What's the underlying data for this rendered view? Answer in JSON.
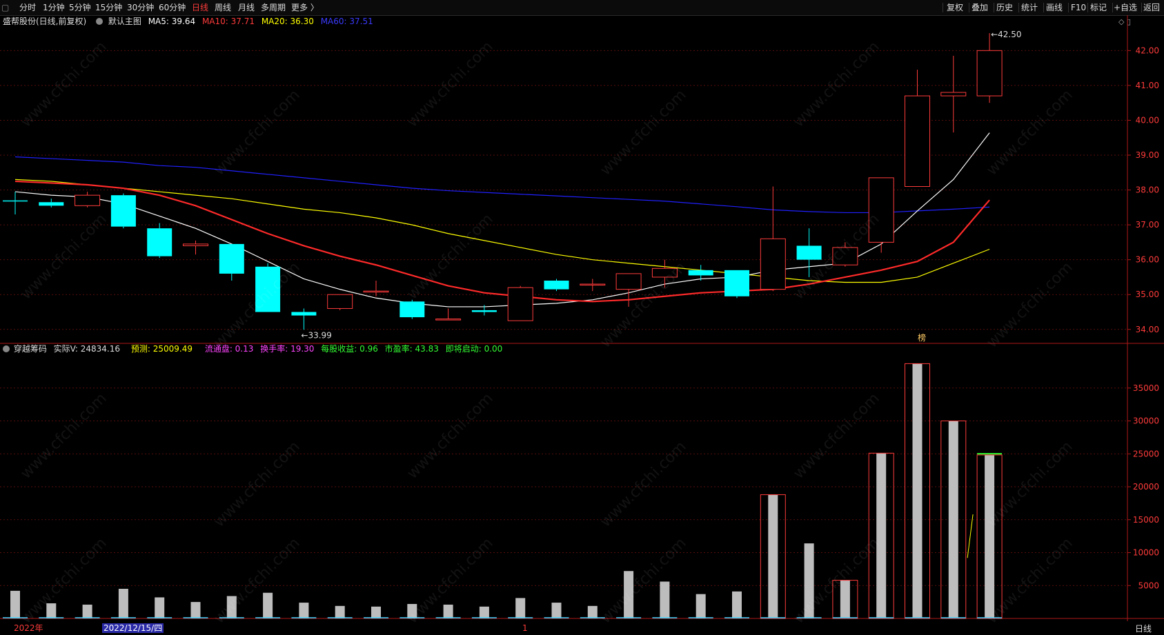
{
  "toolbar": {
    "left_items": [
      "分时",
      "1分钟",
      "5分钟",
      "15分钟",
      "30分钟",
      "60分钟",
      "日线",
      "周线",
      "月线",
      "多周期",
      "更多 〉"
    ],
    "active_item": "日线",
    "right_items": [
      "复权",
      "叠加",
      "历史",
      "统计",
      "画线",
      "F10",
      "标记",
      "+自选",
      "返回"
    ]
  },
  "main_legend": {
    "stock": "盛帮股份(日线,前复权)",
    "template": "默认主图",
    "ma5": "MA5: 39.64",
    "ma10": "MA10: 37.71",
    "ma20": "MA20: 36.30",
    "ma60": "MA60: 37.51"
  },
  "vol_legend": {
    "name": "穿越筹码",
    "actual_v": "实际V: 24834.16",
    "forecast": "预测: 25009.49",
    "float": "流通盘: 0.13",
    "turnover": "换手率: 19.30",
    "eps": "每股收益: 0.96",
    "pe": "市盈率: 43.83",
    "launch": "即将启动: 0.00"
  },
  "colors": {
    "up": "#ff3b3b",
    "down": "#00ffff",
    "ma5": "#ffffff",
    "ma10": "#ff2a2a",
    "ma20": "#ffff00",
    "ma60": "#2020ff",
    "volume_bar": "#bdbdbd",
    "axis": "#ff3b3b"
  },
  "chart_data": {
    "type": "candlestick",
    "price_axis": {
      "ylim": [
        33.6,
        42.6
      ],
      "ticks": [
        "34.00",
        "35.00",
        "36.00",
        "37.00",
        "38.00",
        "39.00",
        "40.00",
        "41.00",
        "42.00"
      ]
    },
    "candles": [
      {
        "o": 37.7,
        "h": 37.95,
        "l": 37.3,
        "c": 37.68
      },
      {
        "o": 37.65,
        "h": 37.75,
        "l": 37.5,
        "c": 37.55
      },
      {
        "o": 37.55,
        "h": 37.95,
        "l": 37.5,
        "c": 37.85
      },
      {
        "o": 37.85,
        "h": 37.9,
        "l": 36.9,
        "c": 36.95
      },
      {
        "o": 36.9,
        "h": 37.05,
        "l": 36.05,
        "c": 36.1
      },
      {
        "o": 36.4,
        "h": 36.55,
        "l": 36.15,
        "c": 36.45
      },
      {
        "o": 36.45,
        "h": 36.45,
        "l": 35.4,
        "c": 35.6
      },
      {
        "o": 35.8,
        "h": 35.9,
        "l": 34.5,
        "c": 34.5
      },
      {
        "o": 34.5,
        "h": 34.6,
        "l": 33.99,
        "c": 34.4
      },
      {
        "o": 34.6,
        "h": 35.0,
        "l": 34.55,
        "c": 35.0
      },
      {
        "o": 35.1,
        "h": 35.4,
        "l": 34.95,
        "c": 35.1
      },
      {
        "o": 34.8,
        "h": 34.85,
        "l": 34.3,
        "c": 34.35
      },
      {
        "o": 34.3,
        "h": 34.6,
        "l": 34.3,
        "c": 34.3
      },
      {
        "o": 34.55,
        "h": 34.7,
        "l": 34.4,
        "c": 34.5
      },
      {
        "o": 34.25,
        "h": 35.25,
        "l": 34.25,
        "c": 35.2
      },
      {
        "o": 35.4,
        "h": 35.45,
        "l": 35.1,
        "c": 35.15
      },
      {
        "o": 35.3,
        "h": 35.45,
        "l": 35.1,
        "c": 35.3
      },
      {
        "o": 35.15,
        "h": 35.6,
        "l": 34.65,
        "c": 35.6
      },
      {
        "o": 35.5,
        "h": 36.0,
        "l": 35.2,
        "c": 35.75
      },
      {
        "o": 35.7,
        "h": 35.85,
        "l": 35.4,
        "c": 35.55
      },
      {
        "o": 35.7,
        "h": 35.7,
        "l": 34.9,
        "c": 34.95
      },
      {
        "o": 35.15,
        "h": 38.1,
        "l": 35.1,
        "c": 36.6
      },
      {
        "o": 36.4,
        "h": 36.9,
        "l": 35.5,
        "c": 36.0
      },
      {
        "o": 35.85,
        "h": 36.5,
        "l": 35.8,
        "c": 36.35
      },
      {
        "o": 36.5,
        "h": 37.75,
        "l": 36.2,
        "c": 38.35
      },
      {
        "o": 38.1,
        "h": 41.45,
        "l": 38.1,
        "c": 40.7
      },
      {
        "o": 40.7,
        "h": 41.85,
        "l": 39.65,
        "c": 40.8
      },
      {
        "o": 40.7,
        "h": 42.5,
        "l": 40.5,
        "c": 42.0
      }
    ],
    "ma5": [
      37.95,
      37.85,
      37.8,
      37.6,
      37.25,
      36.9,
      36.45,
      35.95,
      35.45,
      35.15,
      34.9,
      34.75,
      34.65,
      34.65,
      34.7,
      34.75,
      34.85,
      35.05,
      35.3,
      35.45,
      35.5,
      35.7,
      35.8,
      35.9,
      36.45,
      37.4,
      38.3,
      39.64
    ],
    "ma10": [
      38.25,
      38.2,
      38.15,
      38.05,
      37.85,
      37.55,
      37.15,
      36.75,
      36.4,
      36.1,
      35.85,
      35.55,
      35.25,
      35.05,
      34.95,
      34.85,
      34.8,
      34.85,
      34.95,
      35.05,
      35.1,
      35.15,
      35.3,
      35.5,
      35.7,
      35.95,
      36.5,
      37.71
    ],
    "ma20": [
      38.3,
      38.25,
      38.15,
      38.05,
      37.95,
      37.85,
      37.75,
      37.6,
      37.45,
      37.35,
      37.2,
      37.0,
      36.75,
      36.55,
      36.35,
      36.15,
      36.0,
      35.9,
      35.8,
      35.7,
      35.6,
      35.5,
      35.4,
      35.35,
      35.35,
      35.5,
      35.9,
      36.3
    ],
    "ma60": [
      38.95,
      38.9,
      38.85,
      38.8,
      38.7,
      38.65,
      38.55,
      38.45,
      38.35,
      38.25,
      38.15,
      38.05,
      37.98,
      37.93,
      37.88,
      37.83,
      37.78,
      37.73,
      37.68,
      37.6,
      37.52,
      37.43,
      37.38,
      37.35,
      37.35,
      37.4,
      37.45,
      37.51
    ],
    "annotations": {
      "low": "33.99",
      "high": "42.50",
      "marker": "榜"
    },
    "volume_axis": {
      "ylim": [
        0,
        40000
      ],
      "ticks": [
        "5000",
        "10000",
        "15000",
        "20000",
        "25000",
        "30000",
        "35000"
      ]
    },
    "volume": [
      4200,
      2300,
      2100,
      4500,
      3200,
      2500,
      3400,
      3900,
      2400,
      1900,
      1800,
      2200,
      2100,
      1800,
      3100,
      2400,
      1900,
      7200,
      5600,
      3700,
      4100,
      18800,
      11400,
      5800,
      25100,
      38700,
      30000,
      24834
    ]
  },
  "date_axis": {
    "year": "2022年",
    "selected": "2022/12/15/四",
    "marker": "1"
  },
  "period_label": "日线",
  "watermark": "www.cfchi.com"
}
